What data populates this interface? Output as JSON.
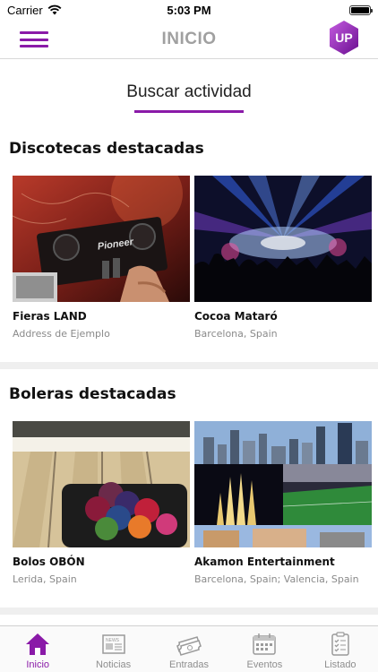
{
  "status_bar": {
    "carrier": "Carrier",
    "time": "5:03 PM"
  },
  "nav": {
    "title": "INICIO",
    "logo_text": "UP"
  },
  "search": {
    "label": "Buscar actividad"
  },
  "sections": [
    {
      "title": "Discotecas destacadas",
      "cards": [
        {
          "name": "Fieras LAND",
          "address": "Address de Ejemplo",
          "image_text": "Pioneer"
        },
        {
          "name": "Cocoa Mataró",
          "address": "Barcelona, Spain"
        }
      ]
    },
    {
      "title": "Boleras destacadas",
      "cards": [
        {
          "name": "Bolos OBÓN",
          "address": "Lerida, Spain"
        },
        {
          "name": "Akamon Entertainment",
          "address": "Barcelona, Spain; Valencia, Spain"
        }
      ]
    }
  ],
  "tabs": [
    {
      "label": "Inicio",
      "icon": "home-icon",
      "active": true
    },
    {
      "label": "Noticias",
      "icon": "newspaper-icon",
      "active": false
    },
    {
      "label": "Entradas",
      "icon": "ticket-icon",
      "active": false
    },
    {
      "label": "Eventos",
      "icon": "calendar-icon",
      "active": false
    },
    {
      "label": "Listado",
      "icon": "checklist-icon",
      "active": false
    }
  ],
  "colors": {
    "accent": "#8a1aa8",
    "inactive_tab": "#8e8e8e",
    "nav_title": "#a0a0a0"
  }
}
